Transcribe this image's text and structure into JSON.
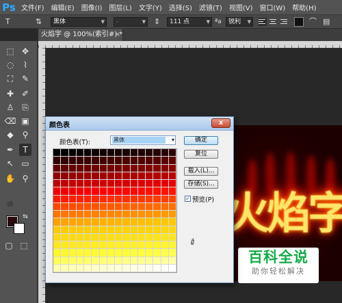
{
  "menubar": {
    "logo": "Ps",
    "items": [
      "文件(F)",
      "编辑(E)",
      "图像(I)",
      "图层(L)",
      "文字(Y)",
      "选择(S)",
      "滤镜(T)",
      "视图(V)",
      "窗口(W)",
      "帮助(H)"
    ]
  },
  "options": {
    "tool_glyph": "T",
    "orient_glyph": "⇅",
    "font_family": "黑体",
    "font_style": "-",
    "size_glyph": "⇕",
    "font_size": "111 点",
    "aa_glyph": "ªa",
    "antialias": "锐利"
  },
  "tab": {
    "title": "火焰字 @ 100%(索引#) *",
    "close": "×"
  },
  "tools": {
    "glyphs": [
      "⬚",
      "✥",
      "◌",
      "⌇",
      "⛶",
      "✎",
      "✚",
      "✐",
      "♙",
      "⎘",
      "⌫",
      "▣",
      "◆",
      "⚲",
      "✒",
      "T",
      "↖",
      "▭",
      "✋",
      "⚲",
      "⇆",
      "⬛",
      "▢",
      "⬚"
    ]
  },
  "canvas": {
    "text": "火焰字"
  },
  "watermark": {
    "title": "百科全说",
    "subtitle": "助你轻松解决"
  },
  "dialog": {
    "title": "颜色表",
    "close": "x",
    "table_label": "颜色表(T):",
    "table_value": "黑体",
    "dropdown_arrow": "▾",
    "buttons": {
      "ok": "确定",
      "reset": "复位",
      "load": "载入(L)...",
      "save": "存储(S)..."
    },
    "preview_label": "预览(P)",
    "preview_checked": "✓",
    "eyedropper": "✐",
    "palette_start_color": "#000000",
    "palette_end_color": "#ffffff",
    "palette_size": 256
  }
}
